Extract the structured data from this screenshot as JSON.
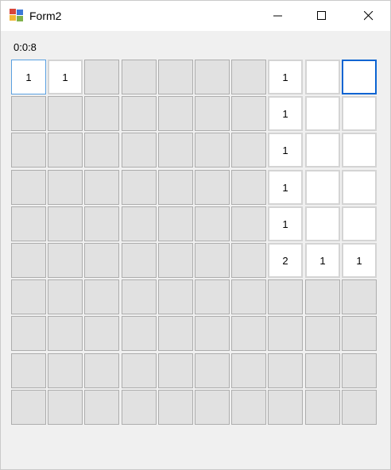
{
  "window": {
    "title": "Form2"
  },
  "icons": {
    "app": "app-icon",
    "minimize": "minimize-icon",
    "maximize": "maximize-icon",
    "close": "close-icon"
  },
  "timer": "0:0:8",
  "board": {
    "rows": 10,
    "cols": 10,
    "cells": [
      [
        "1",
        "1",
        "",
        "",
        "",
        "",
        "",
        "1",
        "_",
        ">"
      ],
      [
        "",
        "",
        "",
        "",
        "",
        "",
        "",
        "1",
        "_",
        "_"
      ],
      [
        "",
        "",
        "",
        "",
        "",
        "",
        "",
        "1",
        "_",
        "_"
      ],
      [
        "",
        "",
        "",
        "",
        "",
        "",
        "",
        "1",
        "_",
        "_"
      ],
      [
        "",
        "",
        "",
        "",
        "",
        "",
        "",
        "1",
        "_",
        "_"
      ],
      [
        "",
        "",
        "",
        "",
        "",
        "",
        "",
        "2",
        "1",
        "1"
      ],
      [
        "",
        "",
        "",
        "",
        "",
        "",
        "",
        "",
        "",
        ""
      ],
      [
        "",
        "",
        "",
        "",
        "",
        "",
        "",
        "",
        "",
        ""
      ],
      [
        "",
        "",
        "",
        "",
        "",
        "",
        "",
        "",
        "",
        ""
      ],
      [
        "",
        "",
        "",
        "",
        "",
        "",
        "",
        "",
        "",
        ""
      ]
    ],
    "legend": {
      "closed": "",
      "open_empty": "_",
      "focused_empty": ">"
    }
  }
}
